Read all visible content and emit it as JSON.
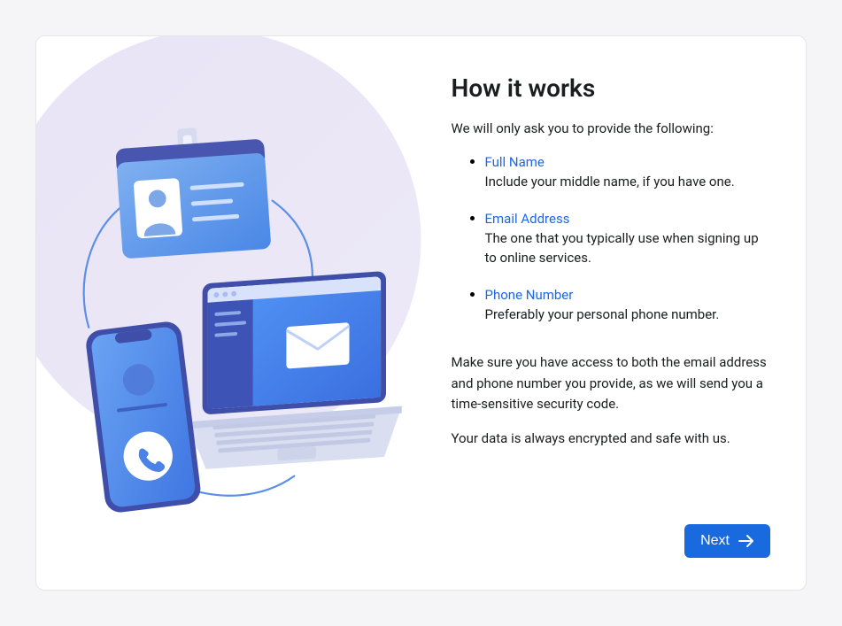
{
  "header": {
    "title": "How it works"
  },
  "intro": "We will only ask you to provide the following:",
  "items": [
    {
      "label": "Full Name",
      "desc": "Include your middle name, if you have one."
    },
    {
      "label": "Email Address",
      "desc": "The one that you typically use when signing up to online services."
    },
    {
      "label": "Phone Number",
      "desc": "Preferably your personal phone number."
    }
  ],
  "note": "Make sure you have access to both the email address and phone number you provide, as we will send you a time-sensitive security code.",
  "safe": "Your data is always encrypted and safe with us.",
  "next_label": "Next",
  "colors": {
    "accent": "#186ade",
    "link": "#1c68eb"
  }
}
